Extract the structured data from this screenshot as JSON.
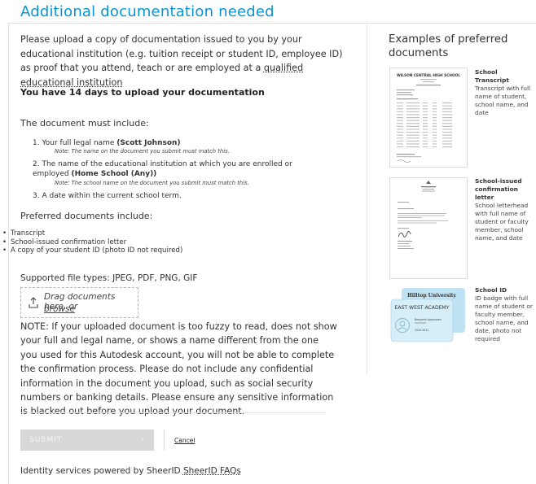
{
  "header": {
    "title": "Additional documentation needed"
  },
  "intro": {
    "text": "Please upload a copy of documentation issued to you by your educational institution (e.g. tuition receipt or student ID, employee ID) as proof that you attend, teach or are employed at a ",
    "link": "qualified educational institution"
  },
  "deadline": "You have 14 days to upload your documentation",
  "requirements": {
    "heading": "The document must include:",
    "items": [
      {
        "num": "1.",
        "text": "Your full legal name ",
        "bold": "(Scott Johnson)",
        "note": "Note: The name on the document you submit must match this."
      },
      {
        "num": "2.",
        "text": "The name of the educational institution at which you are enrolled or employed ",
        "bold": "(Home School (Any))",
        "note": "Note: The school name on the document you submit must match this."
      },
      {
        "num": "3.",
        "text": "A date within the current school term.",
        "bold": "",
        "note": ""
      }
    ]
  },
  "preferred": {
    "heading": "Preferred documents include:",
    "items": [
      "Transcript",
      "School-issued confirmation letter",
      "A copy of your student ID (photo ID not required)"
    ]
  },
  "upload": {
    "filetypes": "Supported file types: JPEG, PDF, PNG, GIF",
    "drag_text": "Drag documents here, or",
    "browse": "browse",
    "icon": "upload-icon"
  },
  "warning": "NOTE: If your uploaded document is too fuzzy to read, does not show your full and legal name, or shows a name different from the one you used for this Autodesk account, you will not be able to complete the confirmation process. Please do not include any confidential information in the document you upload, such as social security numbers or banking details. Please ensure any sensitive information is blacked out before you upload your document.",
  "actions": {
    "submit": "SUBMIT",
    "submit_chevron": "›",
    "cancel": "Cancel"
  },
  "footer": {
    "powered": "Identity services powered by SheerID",
    "faq": "SheerID FAQs"
  },
  "examples": {
    "heading": "Examples of preferred documents",
    "items": [
      {
        "title": "School Transcript",
        "desc": "Transcript with full name of student, school name, and date",
        "doc_title": "WILSON CENTRAL HIGH SCHOOL"
      },
      {
        "title": "School-issued confirmation letter",
        "desc": "School letterhead with full name of student or faculty member, school name, and date"
      },
      {
        "title": "School ID",
        "desc": "ID badge with full name of student or faculty member, school name, and date, photo not required",
        "card_back": "Hilltop University",
        "card_front": "EAST WEST ACADEMY",
        "card_name": "Benjamin Appleseed",
        "card_years": "2020-2021"
      }
    ]
  },
  "colors": {
    "accent": "#0696d7",
    "submit_bg": "#d8d8d8",
    "card": "#bfe3f3"
  }
}
